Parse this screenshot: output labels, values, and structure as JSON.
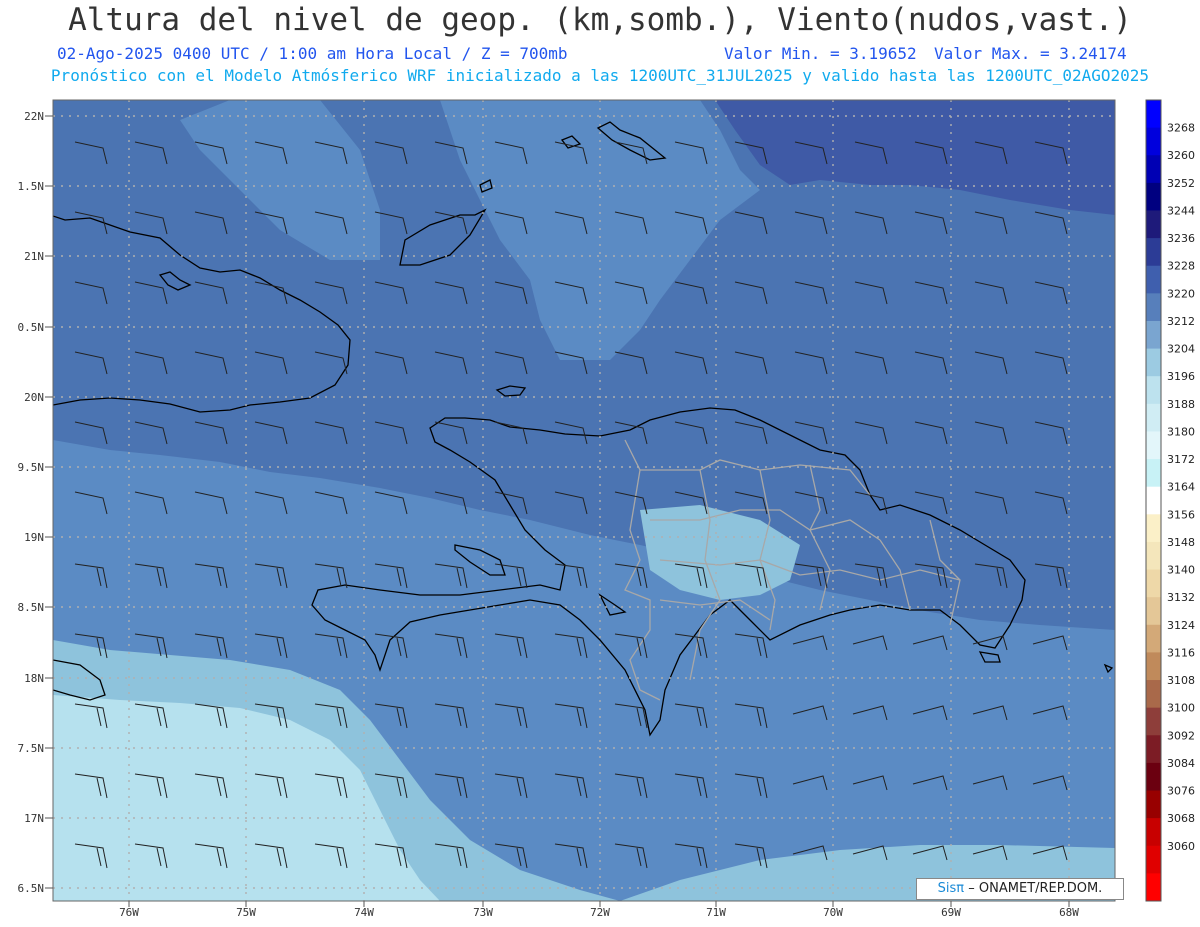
{
  "header": {
    "title": "Altura del nivel de geop. (km,somb.), Viento(nudos,vast.)",
    "date_time": "02-Ago-2025  0400 UTC / 1:00 am Hora Local / Z = 700mb",
    "val_min": "Valor Min. = 3.19652",
    "val_max": "Valor Max. = 3.24174",
    "model_line": "Pronóstico con el Modelo Atmósferico WRF inicializado a las 1200UTC_31JUL2025 y valido hasta las  1200UTC_02AGO2025"
  },
  "axes": {
    "lat_labels": [
      "22N",
      "1.5N",
      "21N",
      "0.5N",
      "20N",
      "9.5N",
      "19N",
      "8.5N",
      "18N",
      "7.5N",
      "17N",
      "6.5N"
    ],
    "lon_labels": [
      "76W",
      "75W",
      "74W",
      "73W",
      "72W",
      "71W",
      "70W",
      "69W",
      "68W"
    ]
  },
  "colorbar": {
    "labels": [
      "3268",
      "3260",
      "3252",
      "3244",
      "3236",
      "3228",
      "3220",
      "3212",
      "3204",
      "3196",
      "3188",
      "3180",
      "3172",
      "3164",
      "3156",
      "3148",
      "3140",
      "3132",
      "3124",
      "3116",
      "3108",
      "3100",
      "3092",
      "3084",
      "3076",
      "3068",
      "3060"
    ],
    "colors": [
      "#0000ff",
      "#0000dd",
      "#0000b4",
      "#000080",
      "#1e1a7a",
      "#2c3c96",
      "#3f5fae",
      "#577fbb",
      "#7aa5d0",
      "#9ccbe2",
      "#bde2ee",
      "#d0edf4",
      "#e3f6fa",
      "#c8f2f6",
      "#ffffff",
      "#fbf0c8",
      "#f4e6bb",
      "#eed8a8",
      "#e4c797",
      "#d3a978",
      "#c08a5b",
      "#a9694a",
      "#8e3e3a",
      "#7c1c25",
      "#6b0010",
      "#980000",
      "#c80000",
      "#e00000",
      "#ff0000"
    ]
  },
  "fill_colors": {
    "band_3228": "#3f5aa6",
    "band_3220": "#4b74b2",
    "band_3212": "#5b8bc4",
    "band_3204": "#8ec3dc",
    "band_3196": "#b6e1ee"
  },
  "credit": {
    "sis": "Sisπ",
    "rest": "– ONAMET/REP.DOM."
  }
}
